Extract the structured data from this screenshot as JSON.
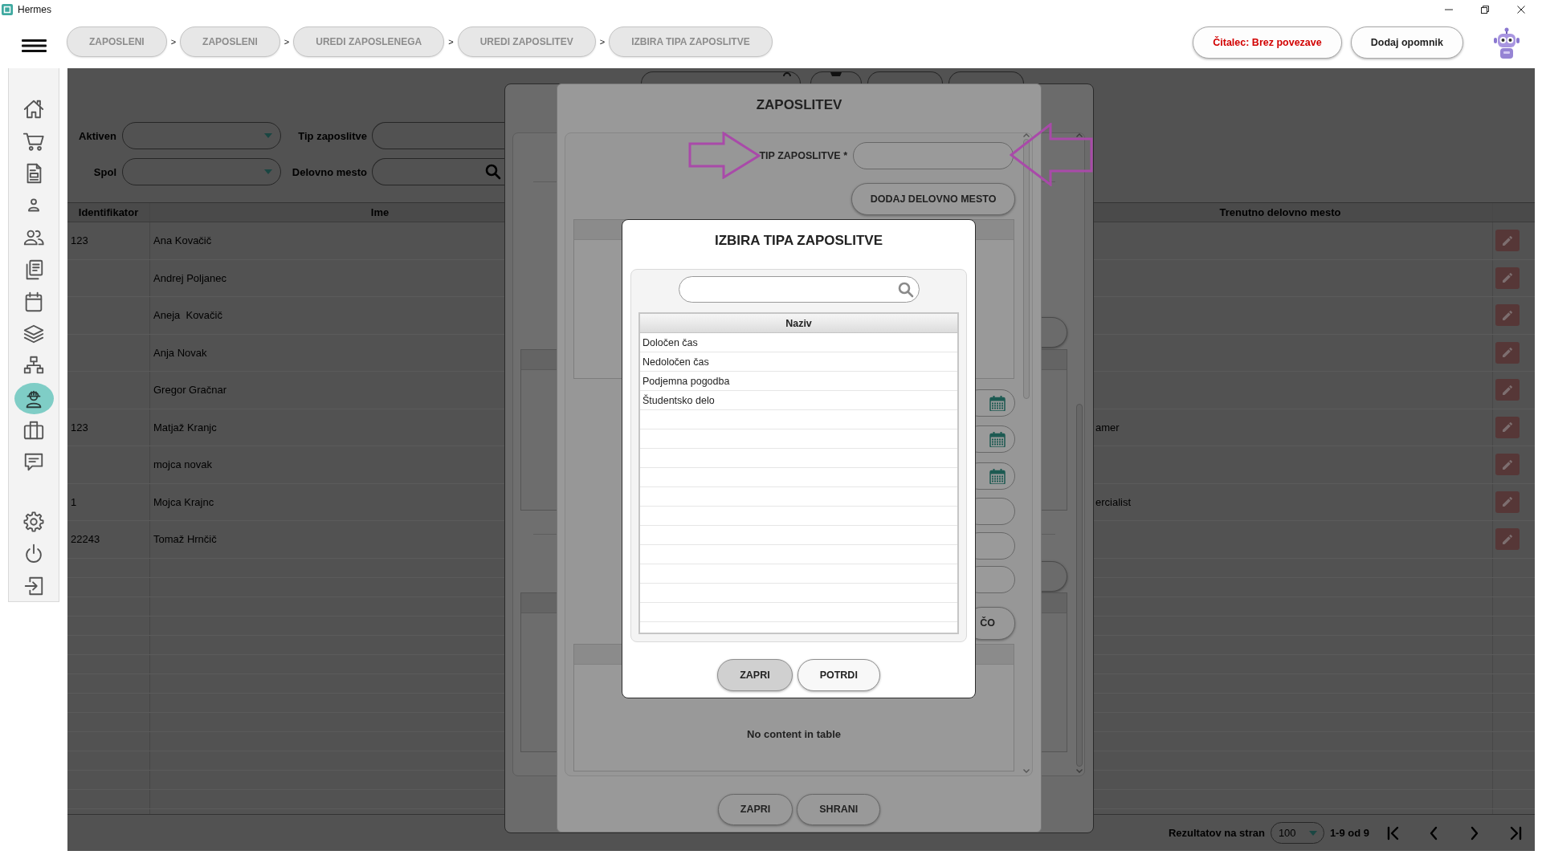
{
  "window": {
    "title": "Hermes"
  },
  "toolbar": {
    "breadcrumbs": [
      {
        "label": "ZAPOSLENI",
        "separator": ">"
      },
      {
        "label": "ZAPOSLENI",
        "separator": ">"
      },
      {
        "label": "UREDI ZAPOSLENEGA",
        "separator": ">"
      },
      {
        "label": "UREDI ZAPOSLITEV",
        "separator": ">"
      },
      {
        "label": "IZBIRA TIPA ZAPOSLITVE"
      }
    ],
    "reader_status": "Čitalec: Brez povezave",
    "reminder_button": "Dodaj opomnik"
  },
  "sidebar": {
    "items": [
      {
        "kind": "home",
        "selected": false
      },
      {
        "kind": "cart",
        "selected": false
      },
      {
        "kind": "document",
        "selected": false
      },
      {
        "kind": "person",
        "selected": false
      },
      {
        "kind": "people",
        "selected": false
      },
      {
        "kind": "documents",
        "selected": false
      },
      {
        "kind": "calendar",
        "selected": false
      },
      {
        "kind": "layers",
        "selected": false
      },
      {
        "kind": "hierarchy",
        "selected": false
      },
      {
        "kind": "worker",
        "selected": true
      },
      {
        "kind": "briefcase",
        "selected": false
      },
      {
        "kind": "chat",
        "selected": false
      }
    ],
    "bottom_items": [
      {
        "kind": "settings",
        "selected": false
      },
      {
        "kind": "power",
        "selected": false
      },
      {
        "kind": "logout",
        "selected": false
      }
    ]
  },
  "filters": [
    {
      "label": "Aktiven",
      "kind": "select"
    },
    {
      "label": "Tip zaposlitve",
      "kind": "text"
    },
    {
      "label": "Spol",
      "kind": "select"
    },
    {
      "label": "Delovno mesto",
      "kind": "search"
    }
  ],
  "table": {
    "columns": [
      "Identifikator",
      "Ime",
      "Trenutno delovno mesto"
    ],
    "rows": [
      {
        "id": "123",
        "name": "Ana Kovačič"
      },
      {
        "name": "Andrej Poljanec"
      },
      {
        "name": "Aneja  Kovačič"
      },
      {
        "name": "Anja Novak"
      },
      {
        "name": "Gregor Gračnar"
      },
      {
        "id": "123",
        "name": "Matjaž Kranjc",
        "position": "amer"
      },
      {
        "name": "mojca novak"
      },
      {
        "id": "1",
        "name": "Mojca Krajnc",
        "position": "ercialist"
      },
      {
        "id": "22243",
        "name": "Tomaž Hrnčič"
      }
    ]
  },
  "pagination": {
    "label": "Rezultatov na stran",
    "page_size": "100",
    "range": "1-9 od 9"
  },
  "employment_dialog": {
    "title": "ZAPOSLITEV",
    "type_label": "TIP ZAPOSLITVE *",
    "add_button": "DODAJ DELOVNO MESTO",
    "side_fields": [
      {
        "kind": "date"
      },
      {
        "kind": "date"
      },
      {
        "kind": "date"
      },
      {
        "kind": "text"
      },
      {
        "kind": "text"
      },
      {
        "kind": "text"
      }
    ],
    "side_button": "ČO",
    "empty_message": "No content in table",
    "buttons": [
      "ZAPRI",
      "SHRANI"
    ]
  },
  "annotations": [
    {
      "kind": "arrow-right"
    },
    {
      "kind": "arrow-left"
    }
  ],
  "type_picker": {
    "title": "IZBIRA TIPA ZAPOSLITVE",
    "column": "Naziv",
    "rows": [
      {
        "label": "Določen čas",
        "selected": false
      },
      {
        "label": "Nedoločen čas",
        "selected": false
      },
      {
        "label": "Podjemna pogodba",
        "selected": false
      },
      {
        "label": "Študentsko delo",
        "selected": false
      }
    ],
    "buttons": [
      {
        "label": "ZAPRI",
        "focused": true
      },
      {
        "label": "POTRDI",
        "focused": false
      }
    ]
  }
}
